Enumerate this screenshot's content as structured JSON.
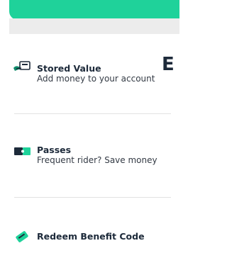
{
  "header": {
    "accent_color": "#1fd29a"
  },
  "partial_heading": "E",
  "items": [
    {
      "icon": "wallet-icon",
      "title": "Stored Value",
      "description": "Add money to your account"
    },
    {
      "icon": "ticket-pass-icon",
      "title": "Passes",
      "description": "Frequent rider? Save money"
    },
    {
      "icon": "ticket-icon",
      "title": "Redeem Benefit Code",
      "description": ""
    }
  ]
}
